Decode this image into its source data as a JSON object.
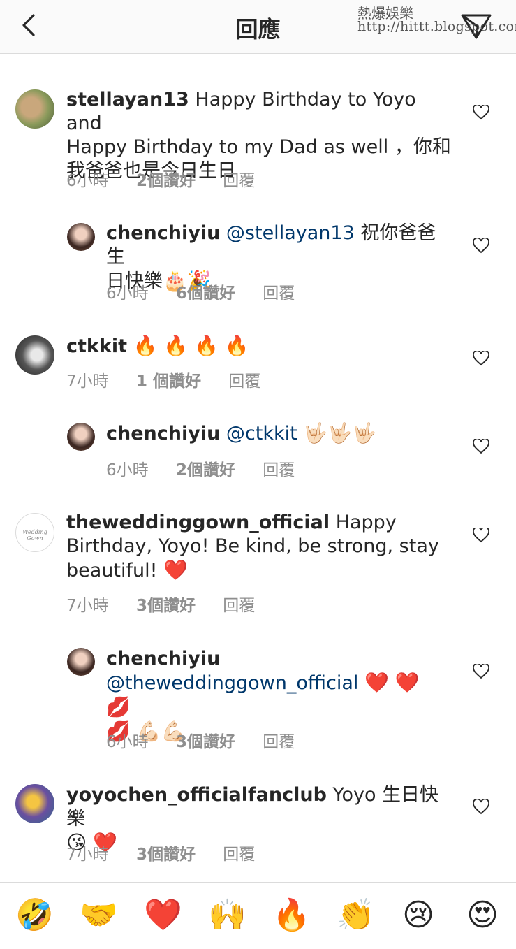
{
  "header": {
    "title": "回應",
    "watermark_name": "熱爆娛樂",
    "watermark_url": "http://hittt.blogspot.com"
  },
  "comments": [
    {
      "user": "stellayan13",
      "line1": "Happy Birthday to Yoyo and",
      "line2": "Happy Birthday to my Dad as well ，你和",
      "line3": "我爸爸也是今日生日",
      "time": "6小時",
      "likes": "2個讚好",
      "reply": "回覆"
    },
    {
      "user": "chenchiyiu",
      "mention": "@stellayan13",
      "line1": "祝你爸爸生",
      "line2": "日快樂",
      "emoji": "🎂🎉",
      "time": "6小時",
      "likes": "6個讚好",
      "reply": "回覆"
    },
    {
      "user": "ctkkit",
      "emoji": "🔥 🔥 🔥 🔥",
      "time": "7小時",
      "likes": "1 個讚好",
      "reply": "回覆"
    },
    {
      "user": "chenchiyiu",
      "mention": "@ctkkit",
      "emoji": "🤟🏻🤟🏻🤟🏻",
      "time": "6小時",
      "likes": "2個讚好",
      "reply": "回覆"
    },
    {
      "user": "theweddinggown_official",
      "line1": "Happy",
      "line2": "Birthday, Yoyo! Be kind, be strong, stay",
      "line3": "beautiful!",
      "emoji": "❤️",
      "avatar_text": "Wedding Gown",
      "time": "7小時",
      "likes": "3個讚好",
      "reply": "回覆"
    },
    {
      "user": "chenchiyiu",
      "mention": "@theweddinggown_official",
      "emoji1": "❤️ ❤️ 💋",
      "emoji2": "💋 💪🏻💪🏻",
      "time": "6小時",
      "likes": "3個讚好",
      "reply": "回覆"
    },
    {
      "user": "yoyochen_officialfanclub",
      "line1": "Yoyo 生日快樂",
      "emoji": "😘 ❤️",
      "time": "7小時",
      "likes": "3個讚好",
      "reply": "回覆"
    }
  ],
  "emoji_bar": [
    "🤣",
    "🤝",
    "❤️",
    "🙌",
    "🔥",
    "👏",
    "😢",
    "😍"
  ],
  "colors": {
    "text": "#262626",
    "meta": "#8e8e8e",
    "mention": "#00376b",
    "divider": "#dbdbdb"
  }
}
